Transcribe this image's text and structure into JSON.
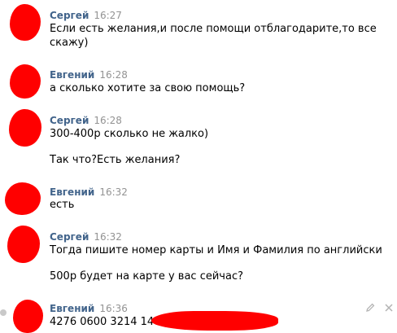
{
  "messages": [
    {
      "author": "Сергей",
      "time": "16:27",
      "lines": [
        "Если есть желания,и после помощи отблагодарите,то все",
        "скажу)"
      ]
    },
    {
      "author": "Евгений",
      "time": "16:28",
      "lines": [
        "а сколько хотите за свою помощь?"
      ]
    },
    {
      "author": "Сергей",
      "time": "16:28",
      "lines": [
        "300-400р сколько не жалко)",
        "Так что?Есть желания?"
      ]
    },
    {
      "author": "Евгений",
      "time": "16:32",
      "lines": [
        "есть"
      ]
    },
    {
      "author": "Сергей",
      "time": "16:32",
      "lines": [
        "Тогда пишите номер карты и Имя и Фамилия по английски",
        "500р будет на карте у вас сейчас?"
      ]
    },
    {
      "author": "Евгений",
      "time": "16:36",
      "lines": [
        "4276 0600 3214 1488"
      ]
    }
  ],
  "colors": {
    "author": "#42648b",
    "time": "#939393",
    "text": "#000000",
    "redaction": "#ff0000"
  },
  "icons": {
    "edit": "pencil-icon",
    "delete": "close-icon",
    "avatar_indicator": "dot-icon"
  }
}
